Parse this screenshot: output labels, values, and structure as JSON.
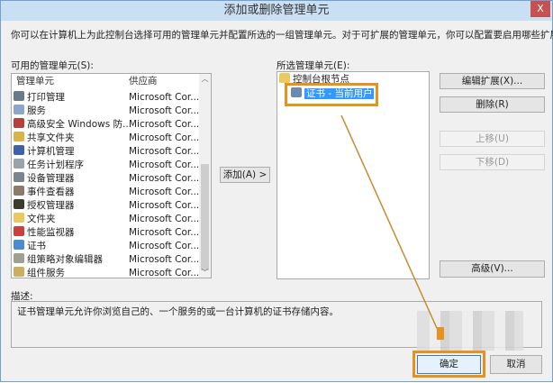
{
  "window": {
    "title": "添加或删除管理单元",
    "close": "X"
  },
  "intro": "你可以在计算机上为此控制台选择可用的管理单元并配置所选的一组管理单元。对于可扩展的管理单元，你可以配置要启用哪些扩展项。",
  "available": {
    "label": "可用的管理单元(S):",
    "col_name": "管理单元",
    "col_vendor": "供应商",
    "items": [
      {
        "name": "打印管理",
        "vendor": "Microsoft Cor...",
        "icon": "printer-icon",
        "color": "#6b7a8a"
      },
      {
        "name": "服务",
        "vendor": "Microsoft Cor...",
        "icon": "gear-icon",
        "color": "#8aa6c8"
      },
      {
        "name": "高级安全 Windows 防...",
        "vendor": "Microsoft Cor...",
        "icon": "firewall-icon",
        "color": "#b4423a"
      },
      {
        "name": "共享文件夹",
        "vendor": "Microsoft Cor...",
        "icon": "shared-folder-icon",
        "color": "#d7b54a"
      },
      {
        "name": "计算机管理",
        "vendor": "Microsoft Cor...",
        "icon": "computer-management-icon",
        "color": "#4060a8"
      },
      {
        "name": "任务计划程序",
        "vendor": "Microsoft Cor...",
        "icon": "clock-icon",
        "color": "#9aa2ac"
      },
      {
        "name": "设备管理器",
        "vendor": "Microsoft Cor...",
        "icon": "device-manager-icon",
        "color": "#7a8590"
      },
      {
        "name": "事件查看器",
        "vendor": "Microsoft Cor...",
        "icon": "event-viewer-icon",
        "color": "#8c7a6a"
      },
      {
        "name": "授权管理器",
        "vendor": "Microsoft Cor...",
        "icon": "authorization-icon",
        "color": "#3c3c2c"
      },
      {
        "name": "文件夹",
        "vendor": "Microsoft Cor...",
        "icon": "folder-icon",
        "color": "#ecc860"
      },
      {
        "name": "性能监视器",
        "vendor": "Microsoft Cor...",
        "icon": "performance-icon",
        "color": "#c84040"
      },
      {
        "name": "证书",
        "vendor": "Microsoft Cor...",
        "icon": "certificate-icon",
        "color": "#4a8ad0"
      },
      {
        "name": "组策略对象编辑器",
        "vendor": "Microsoft Cor...",
        "icon": "policy-icon",
        "color": "#a0a090"
      },
      {
        "name": "组件服务",
        "vendor": "Microsoft Cor...",
        "icon": "component-icon",
        "color": "#c8b060"
      }
    ]
  },
  "add_button": "添加(A) >",
  "selected": {
    "label": "所选管理单元(E):",
    "root": "控制台根节点",
    "child": "证书 - 当前用户"
  },
  "buttons": {
    "edit_ext": "编辑扩展(X)...",
    "remove": "删除(R)",
    "move_up": "上移(U)",
    "move_down": "下移(D)",
    "advanced": "高级(V)...",
    "ok": "确定",
    "cancel": "取消"
  },
  "description": {
    "label": "描述:",
    "text": "证书管理单元允许你浏览自己的、一个服务的或一台计算机的证书存储内容。"
  },
  "colors": {
    "annotation": "#e8921e",
    "selection": "#3399ff"
  }
}
